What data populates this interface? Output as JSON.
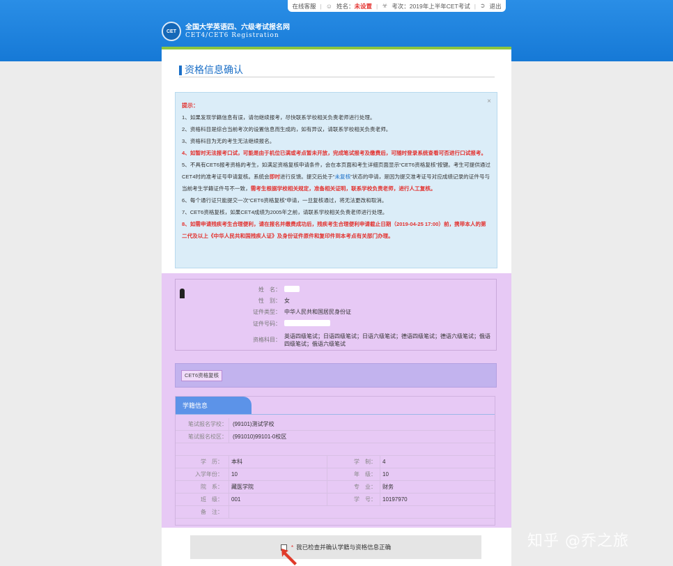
{
  "topbar": {
    "service": "在线客服",
    "name_label": "姓名：",
    "name_value": "未设置",
    "exam_label": "考次：2019年上半年CET考试",
    "logout": "退出"
  },
  "logo": {
    "badge": "CET",
    "line1": "全国大学英语四、六级考试报名网",
    "line2": "CET4/CET6 Registration"
  },
  "section_title": "资格信息确认",
  "tips": {
    "title": "提示：",
    "close": "×",
    "items": [
      "1、如果发现学籍信息有误，请勿继续报考，尽快联系学校相关负责老师进行处理。",
      "2、资格科目是综合当前考次的设置信息而生成的，如有异议，请联系学校相关负责老师。",
      "3、资格科目为无的考生无法继续报名。",
      "4、如暂时无法报考口试，可能是由于机位已满或考点暂未开放，完成笔试报考及缴费后，可随时登录系统查看可否进行口试报考。",
      "5、不具有CET6报考资格的考生，如满足资格复核申请条件，会在本页面和考生详细页面显示“CET6资格复核”按键。考生可提供通过CET4时的准考证号申请复核。系统会",
      "即时",
      "进行反馈。提交后处于“",
      "未复核",
      "”状态的申请，是因为提交准考证号对应成绩记录的证件号与当前考生学籍证件号不一致，",
      "需考生根据学校相关规定，准备相关证明，联系学校负责老师，进行人工复核。",
      "6、每个通行证只能提交一次“CET6资格复核”申请，一旦复核通过，将无法更改和取消。",
      "7、CET6资格复核，如果CET4成绩为2005年之前，请联系学校相关负责老师进行处理。",
      "8、如需申请残疾考生合理便利，请在报名并缴费成功后，残疾考生合理便利申请截止日期（2019-04-25 17:00）前，携带本人的第二代及以上《中华人民共和国残疾人证》及身份证件原件和复印件到本考点有关部门办理。"
    ]
  },
  "person": {
    "name_label": "姓　名：",
    "gender_label": "性　别：",
    "gender_value": "女",
    "id_type_label": "证件类型：",
    "id_type_value": "中华人民共和国居民身份证",
    "id_no_label": "证件号码：",
    "subjects_label": "资格科目：",
    "subjects_value": "英语四级笔试；日语四级笔试；日语六级笔试；德语四级笔试；德语六级笔试；俄语四级笔试；俄语六级笔试"
  },
  "recheck_button": "CET6资格复核",
  "study": {
    "title": "学籍信息",
    "school_label": "笔试报名学校：",
    "school_value": "(99101)测试学校",
    "campus_label": "笔试报名校区：",
    "campus_value": "(991010)99101-0校区",
    "education_label": "学　历：",
    "education_value": "本科",
    "length_label": "学　制：",
    "length_value": "4",
    "enroll_label": "入学年份：",
    "enroll_value": "10",
    "grade_label": "年　级：",
    "grade_value": "10",
    "dept_label": "院　系：",
    "dept_value": "藏医学院",
    "major_label": "专　业：",
    "major_value": "财务",
    "class_label": "班　级：",
    "class_value": "001",
    "stuno_label": "学　号：",
    "stuno_value": "10197970",
    "remark_label": "备　注："
  },
  "confirm": {
    "star": "*",
    "text": "我已检查并确认学籍与资格信息正确"
  },
  "watermark": "知乎 @乔之旅"
}
